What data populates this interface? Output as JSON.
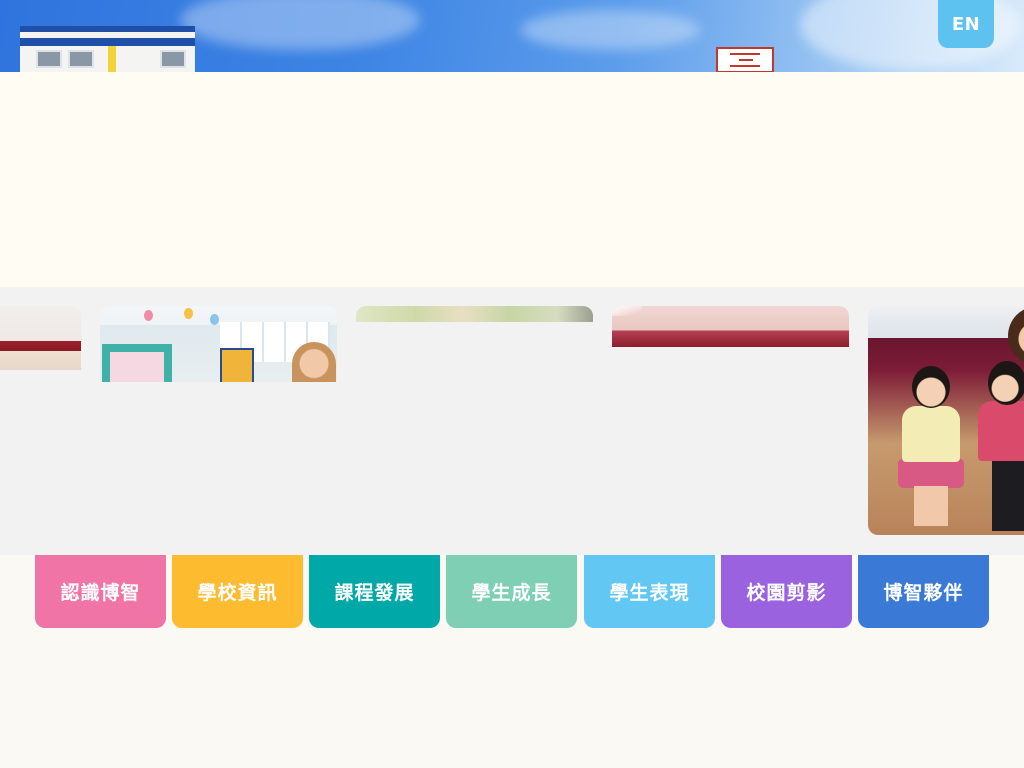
{
  "header": {
    "language_button_label": "EN"
  },
  "nav": {
    "items": [
      {
        "label": "認識博智",
        "color": "#f075a6"
      },
      {
        "label": "學校資訊",
        "color": "#fdbb2f"
      },
      {
        "label": "課程發展",
        "color": "#00a8a8"
      },
      {
        "label": "學生成長",
        "color": "#7ecfb3"
      },
      {
        "label": "學生表現",
        "color": "#62c7f2"
      },
      {
        "label": "校園剪影",
        "color": "#9b62e0"
      },
      {
        "label": "博智夥伴",
        "color": "#3a79d6"
      }
    ]
  },
  "colors": {
    "page_background": "#fbf9f4",
    "intro_background": "#fffcf4",
    "gallery_background": "#f2f2f2",
    "language_button": "#5ec2f0"
  },
  "icons": {
    "school_logo": "red-rectangular-seal-sign"
  }
}
